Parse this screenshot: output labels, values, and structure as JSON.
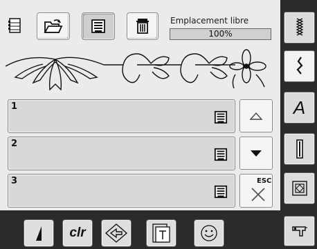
{
  "header": {
    "free_space_label": "Emplacement libre",
    "free_space_value": "100%",
    "free_space_fraction": 1.0
  },
  "toolbar": {
    "icons": [
      "memory-icon",
      "open-folder-icon",
      "save-disk-icon",
      "trash-icon"
    ]
  },
  "slots": [
    {
      "number": "1",
      "icon": "save-disk-icon"
    },
    {
      "number": "2",
      "icon": "save-disk-icon"
    },
    {
      "number": "3",
      "icon": "save-disk-icon"
    }
  ],
  "side_buttons": {
    "esc_label": "ESC"
  },
  "right_menu": {
    "italic_a": "A",
    "icons": [
      "stitch-icon",
      "zigzag-icon",
      "alphabet-icon",
      "buttonhole-icon",
      "quilt-icon",
      "machine-icon"
    ]
  },
  "bottom_bar": {
    "clr_label": "clr",
    "icons": [
      "needle-icon",
      "clear-icon",
      "back-arrow-icon",
      "document-icon",
      "smiley-icon"
    ]
  },
  "colors": {
    "panel_bg": "#ebebeb",
    "dark_frame": "#2b2b2b",
    "slot_bg": "#d8d8d8"
  }
}
